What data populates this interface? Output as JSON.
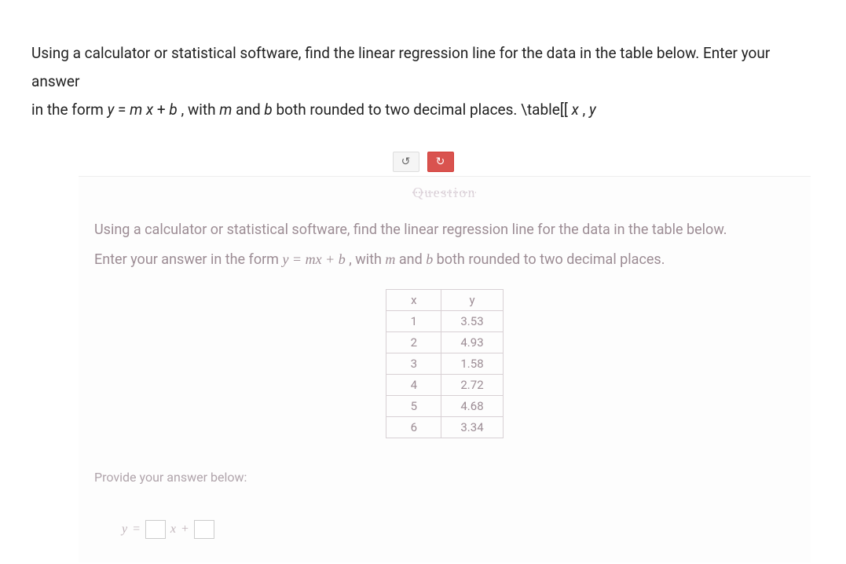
{
  "question": {
    "line1_pre": "Using a calculator or statistical software, find the linear regression line for the data in the table below. Enter your answer",
    "line2_pre": "in the form ",
    "eq_y": "y",
    "eq_eq": " = ",
    "eq_m": "m",
    "eq_x": "x",
    "eq_plus": " + ",
    "eq_b": "b",
    "line2_mid": ",  with ",
    "var_m": "m",
    "and": " and ",
    "var_b": "b",
    "line2_post": " both rounded to two decimal places. \\table[[",
    "tail_x": "x",
    "comma": ", ",
    "tail_y": "y"
  },
  "buttons": {
    "undo": "↺",
    "redo": "↻"
  },
  "embedded": {
    "header": "Question",
    "line1": "Using a calculator or statistical software, find the linear regression line for the data in the table below.",
    "line2_pre": "Enter your answer in the form ",
    "eq": "y = mx + b",
    "line2_mid": ", with ",
    "var_m": "m",
    "and": " and ",
    "var_b": "b",
    "line2_post": " both rounded to two decimal places."
  },
  "table": {
    "headers": {
      "x": "x",
      "y": "y"
    },
    "rows": [
      {
        "x": "1",
        "y": "3.53"
      },
      {
        "x": "2",
        "y": "4.93"
      },
      {
        "x": "3",
        "y": "1.58"
      },
      {
        "x": "4",
        "y": "2.72"
      },
      {
        "x": "5",
        "y": "4.68"
      },
      {
        "x": "6",
        "y": "3.34"
      }
    ]
  },
  "answer": {
    "prompt": "Provide your answer below:",
    "y": "y",
    "eq": "=",
    "m_val": "",
    "x": "x",
    "plus": "+",
    "b_val": ""
  },
  "chart_data": {
    "type": "table",
    "columns": [
      "x",
      "y"
    ],
    "rows": [
      [
        1,
        3.53
      ],
      [
        2,
        4.93
      ],
      [
        3,
        1.58
      ],
      [
        4,
        2.72
      ],
      [
        5,
        4.68
      ],
      [
        6,
        3.34
      ]
    ]
  }
}
